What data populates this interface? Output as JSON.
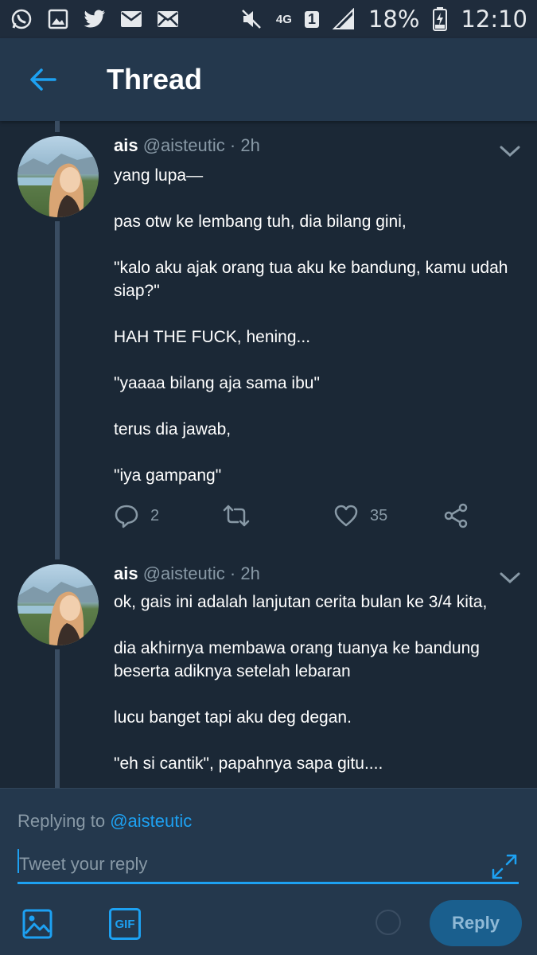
{
  "status_bar": {
    "network": "4G",
    "sim": "1",
    "battery": "18%",
    "time": "12:10"
  },
  "header": {
    "title": "Thread"
  },
  "tweets": [
    {
      "author": "ais",
      "handle": "@aisteutic",
      "time": "· 2h",
      "lines": [
        "yang lupa—",
        "pas otw ke lembang tuh, dia bilang gini,",
        "\"kalo aku ajak orang tua aku ke bandung, kamu udah siap?\"",
        "HAH THE FUCK, hening...",
        "\"yaaaa bilang aja sama ibu\"",
        "terus dia jawab,",
        "\"iya gampang\""
      ],
      "reply_count": "2",
      "retweet_count": "",
      "like_count": "35"
    },
    {
      "author": "ais",
      "handle": "@aisteutic",
      "time": "· 2h",
      "lines": [
        "ok, gais ini adalah lanjutan cerita bulan ke 3/4 kita,",
        "dia akhirnya membawa orang tuanya ke bandung beserta adiknya setelah lebaran",
        "lucu banget tapi aku deg degan.",
        "\"eh si cantik\", papahnya sapa gitu...."
      ]
    }
  ],
  "composer": {
    "replying_prefix": "Replying to",
    "replying_to": "@aisteutic",
    "placeholder": "Tweet your reply",
    "gif_label": "GIF",
    "reply_button": "Reply"
  },
  "colors": {
    "background": "#1b2836",
    "header": "#24384d",
    "accent": "#1da1f2",
    "muted": "#8899a6"
  }
}
